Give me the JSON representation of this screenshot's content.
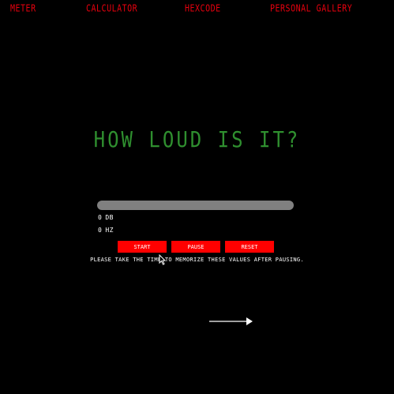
{
  "nav": {
    "meter": "METER",
    "calculator": "CALCULATOR",
    "hexcode": "HEXCODE",
    "gallery": "PERSONAL GALLERY"
  },
  "headline": "HOW LOUD IS IT?",
  "meter": {
    "level": 0,
    "track_color": "#808080",
    "fill_color": "#32c832"
  },
  "readouts": {
    "db_value": "0",
    "db_unit": "DB",
    "hz_value": "0",
    "hz_unit": "HZ"
  },
  "controls": {
    "start": "START",
    "pause": "PAUSE",
    "reset": "RESET"
  },
  "note": "PLEASE TAKE THE TIME TO MEMORIZE THESE VALUES AFTER PAUSING.",
  "icons": {
    "next": "arrow-right-icon",
    "cursor": "mouse-pointer-icon"
  },
  "colors": {
    "background": "#000000",
    "nav": "#e8000e",
    "headline": "#2f8f2f",
    "button": "#ff0000",
    "text": "#ffffff"
  }
}
